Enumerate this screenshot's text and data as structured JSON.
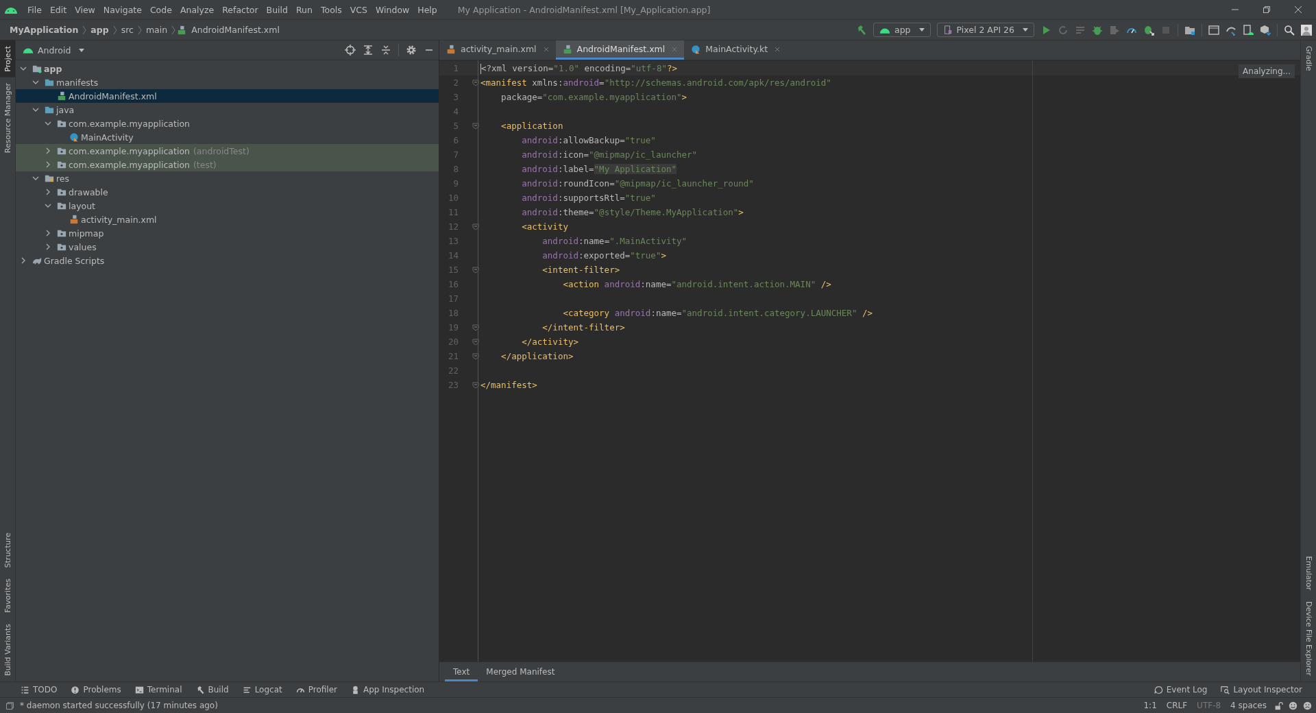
{
  "menu": [
    "File",
    "Edit",
    "View",
    "Navigate",
    "Code",
    "Analyze",
    "Refactor",
    "Build",
    "Run",
    "Tools",
    "VCS",
    "Window",
    "Help"
  ],
  "window": {
    "title": "My Application - AndroidManifest.xml [My_Application.app]"
  },
  "breadcrumb": [
    {
      "label": "MyApplication",
      "kind": "project"
    },
    {
      "label": "app",
      "kind": "module"
    },
    {
      "label": "src",
      "kind": "dir"
    },
    {
      "label": "main",
      "kind": "dir"
    },
    {
      "label": "AndroidManifest.xml",
      "kind": "manifest"
    }
  ],
  "toolbar": {
    "run_config": "app",
    "device": "Pixel 2 API 26"
  },
  "left_strip": [
    {
      "label": "Project",
      "selected": true
    },
    {
      "label": "Resource Manager",
      "selected": false
    },
    {
      "label": "Structure",
      "selected": false
    },
    {
      "label": "Favorites",
      "selected": false
    },
    {
      "label": "Build Variants",
      "selected": false
    }
  ],
  "right_strip": [
    {
      "label": "Gradle"
    },
    {
      "label": "Emulator"
    },
    {
      "label": "Device File Explorer"
    }
  ],
  "project_panel": {
    "view": "Android",
    "tree": [
      {
        "label": "app",
        "kind": "module",
        "bold": true,
        "expanded": true,
        "selected": false,
        "test_source": false,
        "children": [
          {
            "label": "manifests",
            "kind": "folder",
            "expanded": true,
            "selected": false,
            "test_source": false,
            "children": [
              {
                "label": "AndroidManifest.xml",
                "kind": "manifest",
                "selected": true,
                "test_source": false
              }
            ]
          },
          {
            "label": "java",
            "kind": "folder",
            "expanded": true,
            "selected": false,
            "test_source": false,
            "children": [
              {
                "label": "com.example.myapplication",
                "kind": "package",
                "expanded": true,
                "selected": false,
                "test_source": false,
                "children": [
                  {
                    "label": "MainActivity",
                    "kind": "kotlin",
                    "selected": false,
                    "test_source": false
                  }
                ]
              },
              {
                "label": "com.example.myapplication",
                "suffix": "(androidTest)",
                "kind": "package",
                "expanded": false,
                "selected": false,
                "test_source": true
              },
              {
                "label": "com.example.myapplication",
                "suffix": "(test)",
                "kind": "package",
                "expanded": false,
                "selected": false,
                "test_source": true
              }
            ]
          },
          {
            "label": "res",
            "kind": "res",
            "expanded": true,
            "selected": false,
            "test_source": false,
            "children": [
              {
                "label": "drawable",
                "kind": "package",
                "expanded": false,
                "selected": false,
                "test_source": false
              },
              {
                "label": "layout",
                "kind": "package",
                "expanded": true,
                "selected": false,
                "test_source": false,
                "children": [
                  {
                    "label": "activity_main.xml",
                    "kind": "layout",
                    "selected": false,
                    "test_source": false
                  }
                ]
              },
              {
                "label": "mipmap",
                "kind": "package",
                "expanded": false,
                "selected": false,
                "test_source": false
              },
              {
                "label": "values",
                "kind": "package",
                "expanded": false,
                "selected": false,
                "test_source": false
              }
            ]
          }
        ]
      },
      {
        "label": "Gradle Scripts",
        "kind": "gradle",
        "expanded": false,
        "selected": false,
        "test_source": false
      }
    ]
  },
  "editor_tabs": [
    {
      "label": "activity_main.xml",
      "kind": "layout",
      "selected": false
    },
    {
      "label": "AndroidManifest.xml",
      "kind": "manifest",
      "selected": true
    },
    {
      "label": "MainActivity.kt",
      "kind": "kotlin",
      "selected": false
    }
  ],
  "analysis_status": "Analyzing...",
  "code": [
    {
      "n": "1",
      "current": true,
      "fold": false,
      "tokens": [
        {
          "kind": "attr",
          "text": "<?xml version="
        },
        {
          "kind": "str",
          "text": "\"1.0\""
        },
        {
          "kind": "attr",
          "text": " encoding="
        },
        {
          "kind": "str",
          "text": "\"utf-8\""
        },
        {
          "kind": "tag",
          "text": "?>"
        }
      ]
    },
    {
      "n": "2",
      "current": false,
      "fold": true,
      "tokens": [
        {
          "kind": "tag",
          "text": "<manifest"
        },
        {
          "kind": "attr",
          "text": " xmlns:"
        },
        {
          "kind": "ns",
          "text": "android"
        },
        {
          "kind": "attr",
          "text": "="
        },
        {
          "kind": "str",
          "text": "\"http://schemas.android.com/apk/res/android\""
        }
      ]
    },
    {
      "n": "3",
      "current": false,
      "fold": false,
      "tokens": [
        {
          "kind": "attr",
          "text": "    package="
        },
        {
          "kind": "str",
          "text": "\"com.example.myapplication\""
        },
        {
          "kind": "tag",
          "text": ">"
        }
      ]
    },
    {
      "n": "4",
      "current": false,
      "fold": false
    },
    {
      "n": "5",
      "current": false,
      "fold": true,
      "tokens": [
        {
          "kind": "tag",
          "text": "    <application"
        }
      ]
    },
    {
      "n": "6",
      "current": false,
      "fold": false,
      "tokens": [
        {
          "kind": "ns",
          "text": "        android"
        },
        {
          "kind": "attr",
          "text": ":allowBackup="
        },
        {
          "kind": "str",
          "text": "\"true\""
        }
      ]
    },
    {
      "n": "7",
      "current": false,
      "fold": false,
      "tokens": [
        {
          "kind": "ns",
          "text": "        android"
        },
        {
          "kind": "attr",
          "text": ":icon="
        },
        {
          "kind": "str",
          "text": "\"@mipmap/ic_launcher\""
        }
      ]
    },
    {
      "n": "8",
      "current": false,
      "fold": false,
      "tokens": [
        {
          "kind": "ns",
          "text": "        android"
        },
        {
          "kind": "attr",
          "text": ":label="
        },
        {
          "kind": "hl",
          "text": "\"My Application\""
        }
      ]
    },
    {
      "n": "9",
      "current": false,
      "fold": false,
      "tokens": [
        {
          "kind": "ns",
          "text": "        android"
        },
        {
          "kind": "attr",
          "text": ":roundIcon="
        },
        {
          "kind": "str",
          "text": "\"@mipmap/ic_launcher_round\""
        }
      ]
    },
    {
      "n": "10",
      "current": false,
      "fold": false,
      "tokens": [
        {
          "kind": "ns",
          "text": "        android"
        },
        {
          "kind": "attr",
          "text": ":supportsRtl="
        },
        {
          "kind": "str",
          "text": "\"true\""
        }
      ]
    },
    {
      "n": "11",
      "current": false,
      "fold": false,
      "tokens": [
        {
          "kind": "ns",
          "text": "        android"
        },
        {
          "kind": "attr",
          "text": ":theme="
        },
        {
          "kind": "str",
          "text": "\"@style/Theme.MyApplication\""
        },
        {
          "kind": "tag",
          "text": ">"
        }
      ]
    },
    {
      "n": "12",
      "current": false,
      "fold": true,
      "tokens": [
        {
          "kind": "tag",
          "text": "        <activity"
        }
      ]
    },
    {
      "n": "13",
      "current": false,
      "fold": false,
      "tokens": [
        {
          "kind": "ns",
          "text": "            android"
        },
        {
          "kind": "attr",
          "text": ":name="
        },
        {
          "kind": "str",
          "text": "\".MainActivity\""
        }
      ]
    },
    {
      "n": "14",
      "current": false,
      "fold": false,
      "tokens": [
        {
          "kind": "ns",
          "text": "            android"
        },
        {
          "kind": "attr",
          "text": ":exported="
        },
        {
          "kind": "str",
          "text": "\"true\""
        },
        {
          "kind": "tag",
          "text": ">"
        }
      ]
    },
    {
      "n": "15",
      "current": false,
      "fold": true,
      "tokens": [
        {
          "kind": "tag",
          "text": "            <intent-filter>"
        }
      ]
    },
    {
      "n": "16",
      "current": false,
      "fold": false,
      "tokens": [
        {
          "kind": "tag",
          "text": "                <action"
        },
        {
          "kind": "ns",
          "text": " android"
        },
        {
          "kind": "attr",
          "text": ":name="
        },
        {
          "kind": "str",
          "text": "\"android.intent.action.MAIN\""
        },
        {
          "kind": "tag",
          "text": " />"
        }
      ]
    },
    {
      "n": "17",
      "current": false,
      "fold": false
    },
    {
      "n": "18",
      "current": false,
      "fold": false,
      "tokens": [
        {
          "kind": "tag",
          "text": "                <category"
        },
        {
          "kind": "ns",
          "text": " android"
        },
        {
          "kind": "attr",
          "text": ":name="
        },
        {
          "kind": "str",
          "text": "\"android.intent.category.LAUNCHER\""
        },
        {
          "kind": "tag",
          "text": " />"
        }
      ]
    },
    {
      "n": "19",
      "current": false,
      "fold": true,
      "tokens": [
        {
          "kind": "tag",
          "text": "            </intent-filter>"
        }
      ]
    },
    {
      "n": "20",
      "current": false,
      "fold": true,
      "tokens": [
        {
          "kind": "tag",
          "text": "        </activity>"
        }
      ]
    },
    {
      "n": "21",
      "current": false,
      "fold": true,
      "tokens": [
        {
          "kind": "tag",
          "text": "    </application>"
        }
      ]
    },
    {
      "n": "22",
      "current": false,
      "fold": false
    },
    {
      "n": "23",
      "current": false,
      "fold": true,
      "tokens": [
        {
          "kind": "tag",
          "text": "</manifest>"
        }
      ]
    }
  ],
  "bottom_editor_tabs": [
    {
      "label": "Text",
      "selected": true
    },
    {
      "label": "Merged Manifest",
      "selected": false
    }
  ],
  "tool_buttons": [
    {
      "label": "TODO",
      "kind": "list"
    },
    {
      "label": "Problems",
      "kind": "alert"
    },
    {
      "label": "Terminal",
      "kind": "terminal"
    },
    {
      "label": "Build",
      "kind": "hammer"
    },
    {
      "label": "Logcat",
      "kind": "lines"
    },
    {
      "label": "Profiler",
      "kind": "gauge"
    },
    {
      "label": "App Inspection",
      "kind": "inspect"
    }
  ],
  "tool_buttons_right": [
    {
      "label": "Event Log",
      "kind": "bubble"
    },
    {
      "label": "Layout Inspector",
      "kind": "layout-inspect"
    }
  ],
  "status_bar": {
    "message": "* daemon started successfully (17 minutes ago)",
    "position": "1:1",
    "line_separator": "CRLF",
    "encoding": "UTF-8",
    "indent": "4 spaces"
  }
}
